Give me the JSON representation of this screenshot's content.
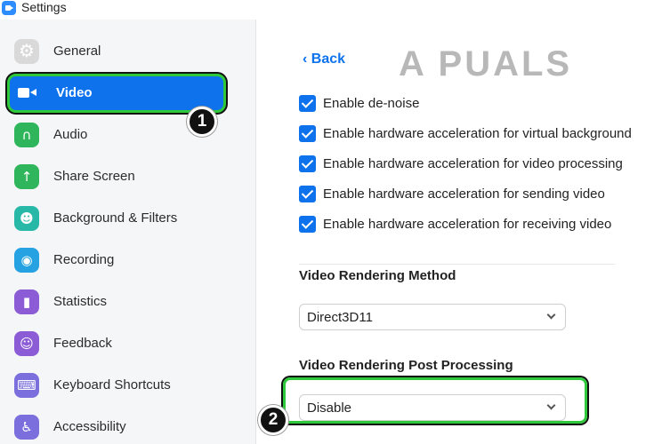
{
  "window": {
    "title": "Settings"
  },
  "sidebar": {
    "items": [
      {
        "label": "General",
        "icon": "gear-icon"
      },
      {
        "label": "Video",
        "icon": "video-camera-icon",
        "active": true
      },
      {
        "label": "Audio",
        "icon": "headphones-icon"
      },
      {
        "label": "Share Screen",
        "icon": "share-screen-icon"
      },
      {
        "label": "Background & Filters",
        "icon": "background-icon"
      },
      {
        "label": "Recording",
        "icon": "record-icon"
      },
      {
        "label": "Statistics",
        "icon": "bar-chart-icon"
      },
      {
        "label": "Feedback",
        "icon": "smiley-icon"
      },
      {
        "label": "Keyboard Shortcuts",
        "icon": "keyboard-icon"
      },
      {
        "label": "Accessibility",
        "icon": "accessibility-icon"
      }
    ]
  },
  "main": {
    "back_label": "Back",
    "checkboxes": [
      {
        "label": "Enable de-noise",
        "checked": true
      },
      {
        "label": "Enable hardware acceleration for virtual background",
        "checked": true
      },
      {
        "label": "Enable hardware acceleration for video processing",
        "checked": true
      },
      {
        "label": "Enable hardware acceleration for sending video",
        "checked": true
      },
      {
        "label": "Enable hardware acceleration for receiving video",
        "checked": true
      }
    ],
    "rendering_method": {
      "title": "Video Rendering Method",
      "value": "Direct3D11"
    },
    "post_processing": {
      "title": "Video Rendering Post Processing",
      "value": "Disable"
    }
  },
  "annotations": {
    "step1": "1",
    "step2": "2",
    "watermark": "A PUALS"
  },
  "colors": {
    "accent": "#0e72ed",
    "highlight": "#2ec83a",
    "sidebar_bg": "#f5f6f7"
  }
}
